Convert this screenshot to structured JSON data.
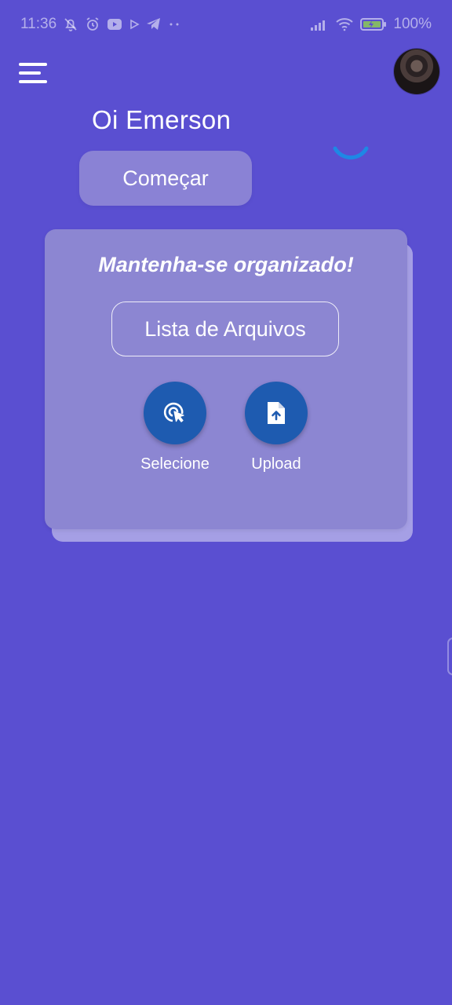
{
  "status_bar": {
    "time": "11:36",
    "battery": "100%",
    "icons": [
      "notifications-off-icon",
      "alarm-icon",
      "youtube-icon",
      "play-icon",
      "telegram-icon",
      "more-dots-icon",
      "signal-icon",
      "wifi-icon",
      "battery-charging-icon"
    ]
  },
  "header": {
    "menu_icon": "hamburger-menu-icon",
    "avatar": "user-avatar"
  },
  "greeting": "Oi Emerson",
  "start_button": "Começar",
  "loading": "loading-spinner",
  "card": {
    "title": "Mantenha-se organizado!",
    "files_button": "Lista de Arquivos",
    "actions": [
      {
        "label": "Selecione",
        "icon": "touch-select-icon"
      },
      {
        "label": "Upload",
        "icon": "file-upload-icon"
      }
    ]
  },
  "colors": {
    "background": "#5a4fd1",
    "card": "#8c86d2",
    "action_button": "#1e5bb0",
    "spinner": "#1e88e5"
  }
}
